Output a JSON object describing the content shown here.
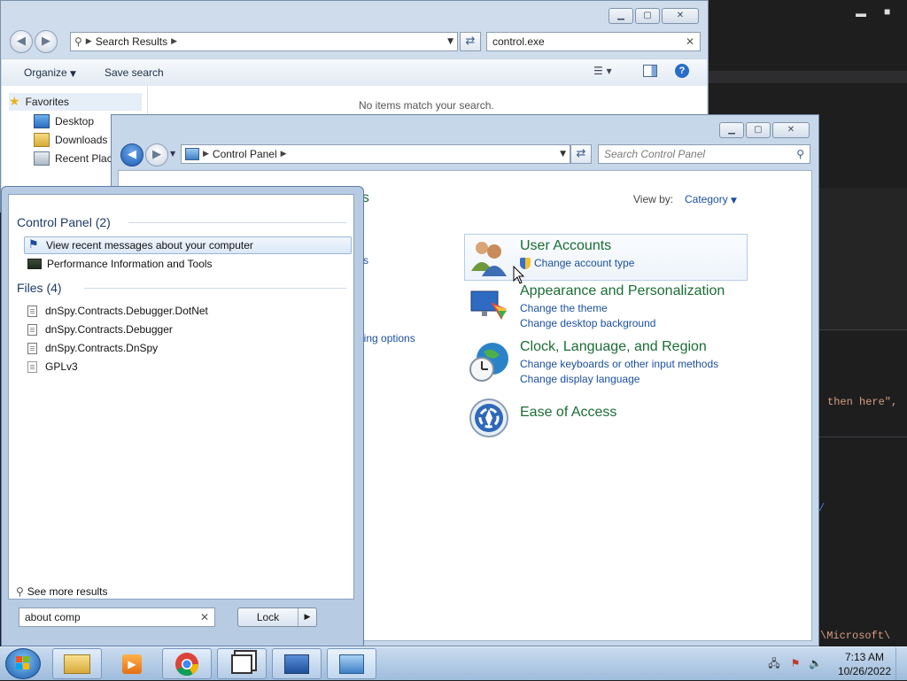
{
  "editor": {
    "code_line_1": "then here\",",
    "code_line_2": "\\Microsoft\\",
    "code_line_3": "/"
  },
  "explorer": {
    "breadcrumb": "Search Results",
    "search_value": "control.exe",
    "toolbar": {
      "organize": "Organize",
      "save_search": "Save search"
    },
    "nav": {
      "favorites": "Favorites",
      "items": [
        "Desktop",
        "Downloads",
        "Recent Places"
      ]
    },
    "empty_message": "No items match your search."
  },
  "control_panel": {
    "breadcrumb": "Control Panel",
    "search_placeholder": "Search Control Panel",
    "view_by_label": "View by:",
    "view_by_value": "Category",
    "partial_texts": [
      "gs",
      "tus",
      "t",
      "aring options",
      "g"
    ],
    "categories": [
      {
        "title": "User Accounts",
        "links": [
          "Change account type"
        ]
      },
      {
        "title": "Appearance and Personalization",
        "links": [
          "Change the theme",
          "Change desktop background"
        ]
      },
      {
        "title": "Clock, Language, and Region",
        "links": [
          "Change keyboards or other input methods",
          "Change display language"
        ]
      },
      {
        "title": "Ease of Access",
        "links": []
      }
    ]
  },
  "start_menu": {
    "groups": [
      {
        "header": "Control Panel (2)",
        "items": [
          "View recent messages about your computer",
          "Performance Information and Tools"
        ]
      },
      {
        "header": "Files (4)",
        "items": [
          "dnSpy.Contracts.Debugger.DotNet",
          "dnSpy.Contracts.Debugger",
          "dnSpy.Contracts.DnSpy",
          "GPLv3"
        ]
      }
    ],
    "see_more": "See more results",
    "search_value": "about comp",
    "lock_label": "Lock"
  },
  "taskbar": {
    "time": "7:13 AM",
    "date": "10/26/2022"
  },
  "colors": {
    "category_title": "#1a6d35",
    "link": "#1a4f9e",
    "start_header": "#1e3a6a"
  }
}
